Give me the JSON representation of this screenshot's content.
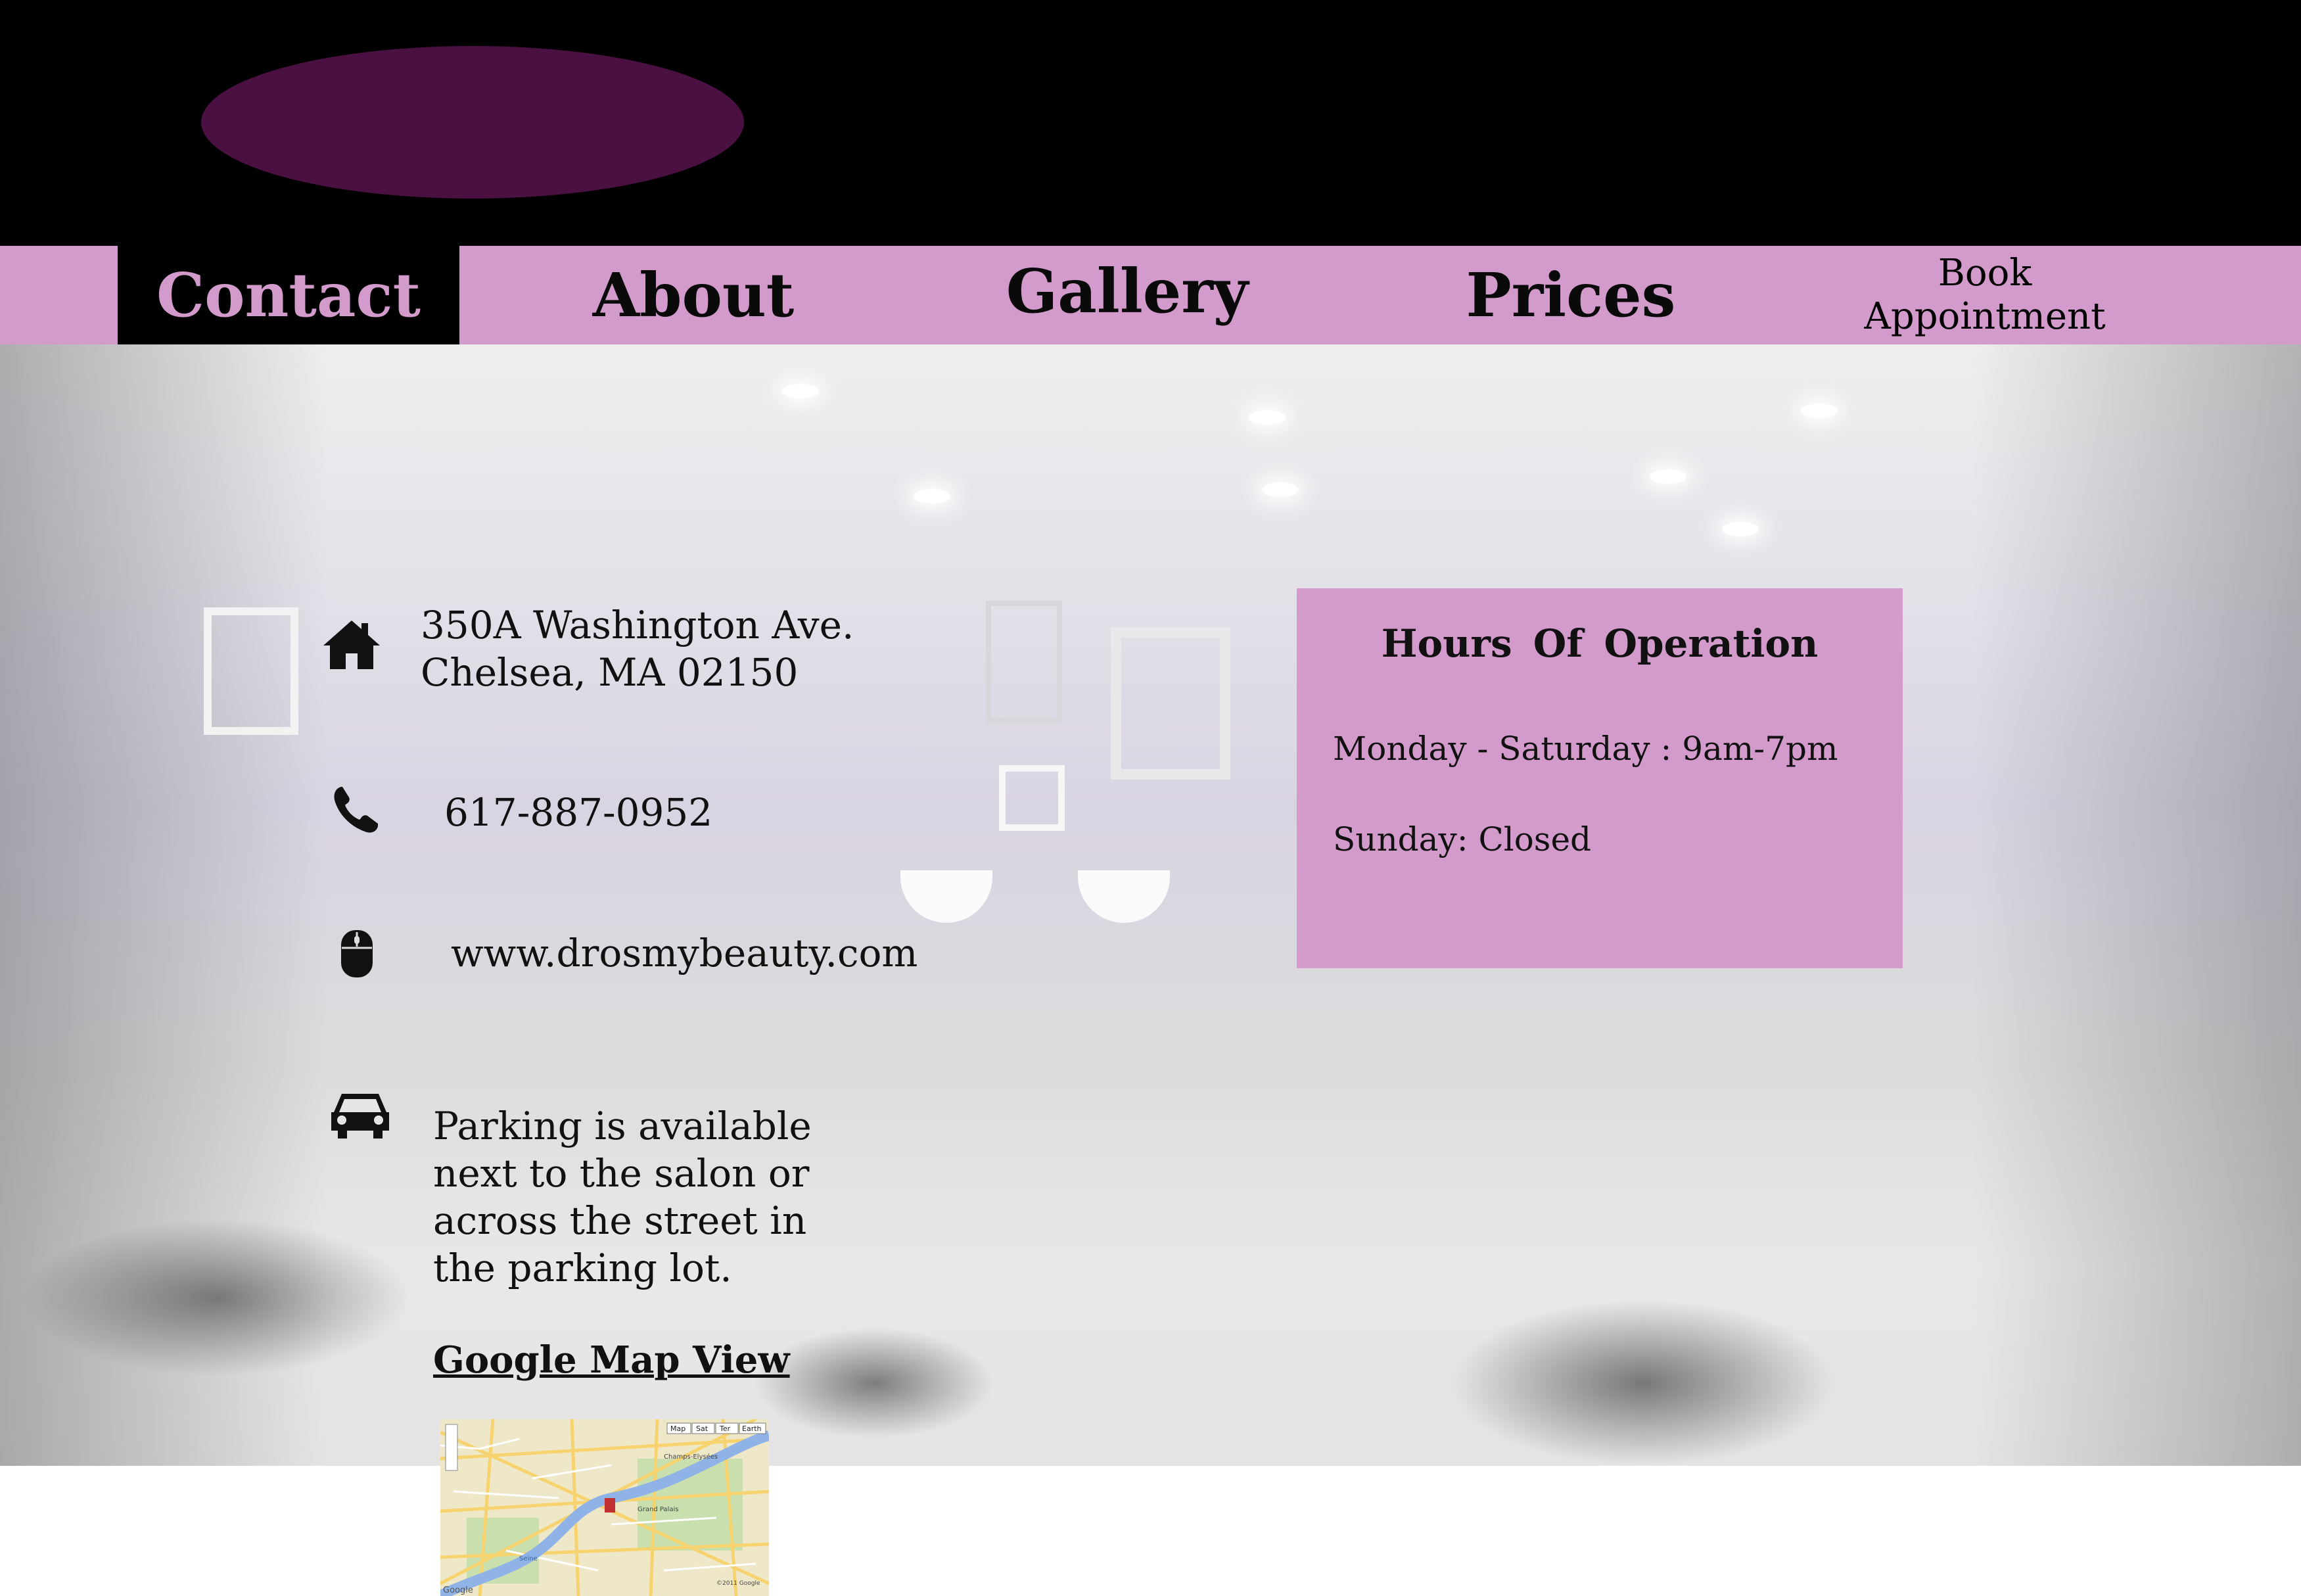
{
  "nav": {
    "contact": "Contact",
    "about": "About",
    "gallery": "Gallery",
    "prices": "Prices",
    "book_line1": "Book",
    "book_line2": "Appointment"
  },
  "contact": {
    "address": "350A Washington Ave.\nChelsea, MA 02150",
    "phone": "617-887-0952",
    "website": "www.drosmybeauty.com",
    "parking": "Parking is available\nnext to the salon or\nacross the street in\nthe parking lot.",
    "map_link": "Google Map View"
  },
  "hours": {
    "title": "Hours  Of  Operation",
    "weekdays": "Monday - Saturday : 9am-7pm",
    "sunday": "Sunday: Closed"
  },
  "map": {
    "buttons": [
      "Map",
      "Sat",
      "Ter",
      "Earth"
    ],
    "places": [
      "Champs-Elysées",
      "Grand Palais",
      "Seine"
    ],
    "brand": "Google",
    "copyright": "©2011 Google"
  },
  "colors": {
    "header": "#000000",
    "logo": "#4a1041",
    "nav": "#d39bcb",
    "hours_box": "#d39bcb"
  }
}
